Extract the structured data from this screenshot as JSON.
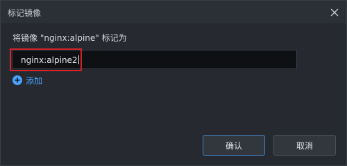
{
  "dialog": {
    "title": "标记镜像",
    "close_icon": "close-icon",
    "prompt": "将镜像 \"nginx:alpine\" 标记为",
    "tag_input": {
      "value": "nginx:alpine2"
    },
    "add_link": {
      "label": "添加",
      "icon": "plus-circle-icon"
    },
    "buttons": {
      "ok": "确认",
      "cancel": "取消"
    }
  },
  "colors": {
    "background": "#262a30",
    "input_background": "#0e1013",
    "accent": "#4aa3ff",
    "highlight": "#d2232a"
  }
}
